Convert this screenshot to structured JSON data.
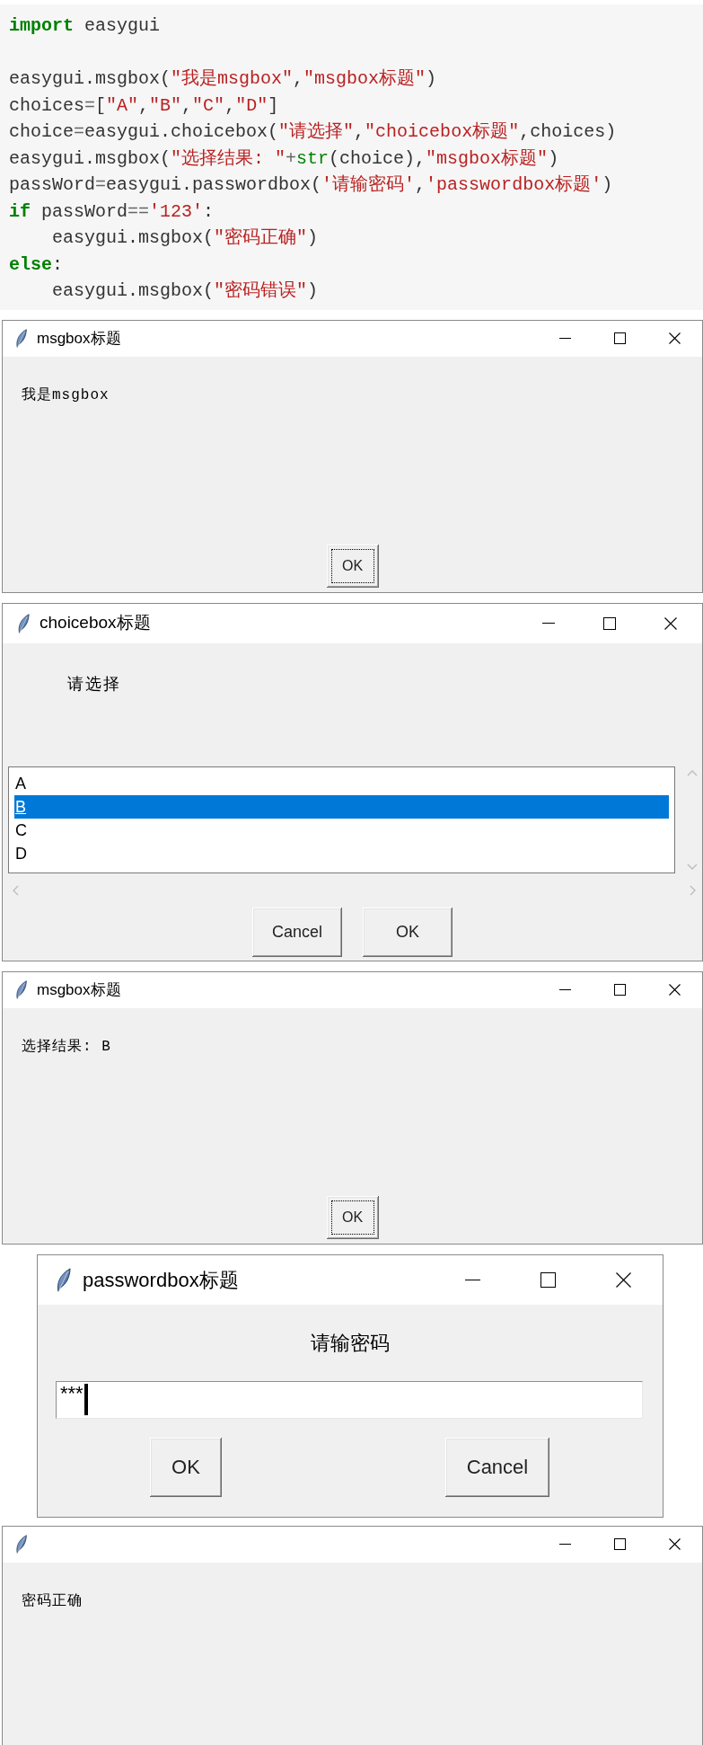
{
  "code": {
    "blocks": [
      {
        "lines": [
          {
            "tokens": [
              {
                "text": "import",
                "kind": "keyword"
              },
              {
                "text": " easygui",
                "kind": "plain"
              }
            ]
          }
        ]
      },
      {
        "lines": [
          {
            "tokens": [
              {
                "text": "easygui.msgbox(",
                "kind": "plain"
              },
              {
                "text": "\"我是msgbox\"",
                "kind": "string"
              },
              {
                "text": ",",
                "kind": "plain"
              },
              {
                "text": "\"msgbox标题\"",
                "kind": "string"
              },
              {
                "text": ")",
                "kind": "plain"
              }
            ]
          },
          {
            "tokens": [
              {
                "text": "choices",
                "kind": "plain"
              },
              {
                "text": "=",
                "kind": "operator"
              },
              {
                "text": "[",
                "kind": "plain"
              },
              {
                "text": "\"A\"",
                "kind": "string"
              },
              {
                "text": ",",
                "kind": "plain"
              },
              {
                "text": "\"B\"",
                "kind": "string"
              },
              {
                "text": ",",
                "kind": "plain"
              },
              {
                "text": "\"C\"",
                "kind": "string"
              },
              {
                "text": ",",
                "kind": "plain"
              },
              {
                "text": "\"D\"",
                "kind": "string"
              },
              {
                "text": "]",
                "kind": "plain"
              }
            ]
          },
          {
            "tokens": [
              {
                "text": "choice",
                "kind": "plain"
              },
              {
                "text": "=",
                "kind": "operator"
              },
              {
                "text": "easygui.choicebox(",
                "kind": "plain"
              },
              {
                "text": "\"请选择\"",
                "kind": "string"
              },
              {
                "text": ",",
                "kind": "plain"
              },
              {
                "text": "\"choicebox标题\"",
                "kind": "string"
              },
              {
                "text": ",choices)",
                "kind": "plain"
              }
            ]
          },
          {
            "tokens": [
              {
                "text": "easygui.msgbox(",
                "kind": "plain"
              },
              {
                "text": "\"选择结果: \"",
                "kind": "string"
              },
              {
                "text": "+",
                "kind": "operator"
              },
              {
                "text": "str",
                "kind": "builtin"
              },
              {
                "text": "(choice),",
                "kind": "plain"
              },
              {
                "text": "\"msgbox标题\"",
                "kind": "string"
              },
              {
                "text": ")",
                "kind": "plain"
              }
            ]
          },
          {
            "tokens": [
              {
                "text": "passWord",
                "kind": "plain"
              },
              {
                "text": "=",
                "kind": "operator"
              },
              {
                "text": "easygui.passwordbox(",
                "kind": "plain"
              },
              {
                "text": "'请输密码'",
                "kind": "string"
              },
              {
                "text": ",",
                "kind": "plain"
              },
              {
                "text": "'passwordbox标题'",
                "kind": "string"
              },
              {
                "text": ")",
                "kind": "plain"
              }
            ]
          },
          {
            "tokens": [
              {
                "text": "if",
                "kind": "keyword"
              },
              {
                "text": " passWord",
                "kind": "plain"
              },
              {
                "text": "==",
                "kind": "operator"
              },
              {
                "text": "'123'",
                "kind": "string"
              },
              {
                "text": ":",
                "kind": "plain"
              }
            ],
            "children": [
              {
                "tokens": [
                  {
                    "text": "easygui.msgbox(",
                    "kind": "plain"
                  },
                  {
                    "text": "\"密码正确\"",
                    "kind": "string"
                  },
                  {
                    "text": ")",
                    "kind": "plain"
                  }
                ]
              }
            ]
          },
          {
            "tokens": [
              {
                "text": "else",
                "kind": "keyword"
              },
              {
                "text": ":",
                "kind": "plain"
              }
            ],
            "children": [
              {
                "tokens": [
                  {
                    "text": "easygui.msgbox(",
                    "kind": "plain"
                  },
                  {
                    "text": "\"密码错误\"",
                    "kind": "string"
                  },
                  {
                    "text": ")",
                    "kind": "plain"
                  }
                ]
              }
            ]
          }
        ]
      }
    ]
  },
  "windows": [
    {
      "kind": "msgbox",
      "title": "msgbox标题",
      "message": "我是msgbox",
      "buttons": [
        {
          "label": "OK",
          "focused": true
        }
      ]
    },
    {
      "kind": "choicebox",
      "title": "choicebox标题",
      "message": "请选择",
      "choices": [
        {
          "label": "A",
          "selected": false
        },
        {
          "label": "B",
          "selected": true
        },
        {
          "label": "C",
          "selected": false
        },
        {
          "label": "D",
          "selected": false
        }
      ],
      "buttons": [
        {
          "label": "Cancel",
          "focused": false
        },
        {
          "label": "OK",
          "focused": false
        }
      ]
    },
    {
      "kind": "msgbox",
      "title": "msgbox标题",
      "message": "选择结果: B",
      "buttons": [
        {
          "label": "OK",
          "focused": true
        }
      ]
    },
    {
      "kind": "passwordbox",
      "title": "passwordbox标题",
      "message": "请输密码",
      "field": {
        "value": "***",
        "focused": true
      },
      "buttons": [
        {
          "label": "OK",
          "focused": false
        },
        {
          "label": "Cancel",
          "focused": false
        }
      ]
    },
    {
      "kind": "msgbox",
      "message": "密码正确"
    }
  ]
}
